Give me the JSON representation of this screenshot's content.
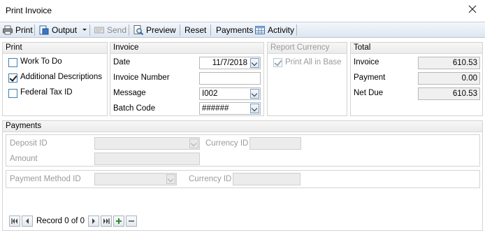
{
  "window": {
    "title": "Print Invoice"
  },
  "toolbar": {
    "print": "Print",
    "output": "Output",
    "send": "Send",
    "preview": "Preview",
    "reset": "Reset",
    "payments": "Payments",
    "activity": "Activity"
  },
  "print_group": {
    "header": "Print",
    "work_to_do": {
      "label": "Work To Do",
      "checked": false
    },
    "additional_descriptions": {
      "label": "Additional Descriptions",
      "checked": true
    },
    "federal_tax_id": {
      "label": "Federal Tax ID",
      "checked": false
    }
  },
  "invoice_group": {
    "header": "Invoice",
    "date_label": "Date",
    "date_value": "11/7/2018",
    "invoice_number_label": "Invoice Number",
    "invoice_number_value": "",
    "message_label": "Message",
    "message_value": "I002",
    "batch_code_label": "Batch Code",
    "batch_code_value": "######"
  },
  "report_currency_group": {
    "header": "Report Currency",
    "print_all_in_base": {
      "label": "Print All in Base",
      "checked": true
    }
  },
  "total_group": {
    "header": "Total",
    "invoice_label": "Invoice",
    "invoice_value": "610.53",
    "payment_label": "Payment",
    "payment_value": "0.00",
    "net_due_label": "Net Due",
    "net_due_value": "610.53"
  },
  "payments_group": {
    "header": "Payments",
    "deposit_id_label": "Deposit ID",
    "currency_id_label_1": "Currency ID",
    "amount_label": "Amount",
    "payment_method_id_label": "Payment Method ID",
    "currency_id_label_2": "Currency ID"
  },
  "record_nav": {
    "text": "Record 0 of 0"
  }
}
